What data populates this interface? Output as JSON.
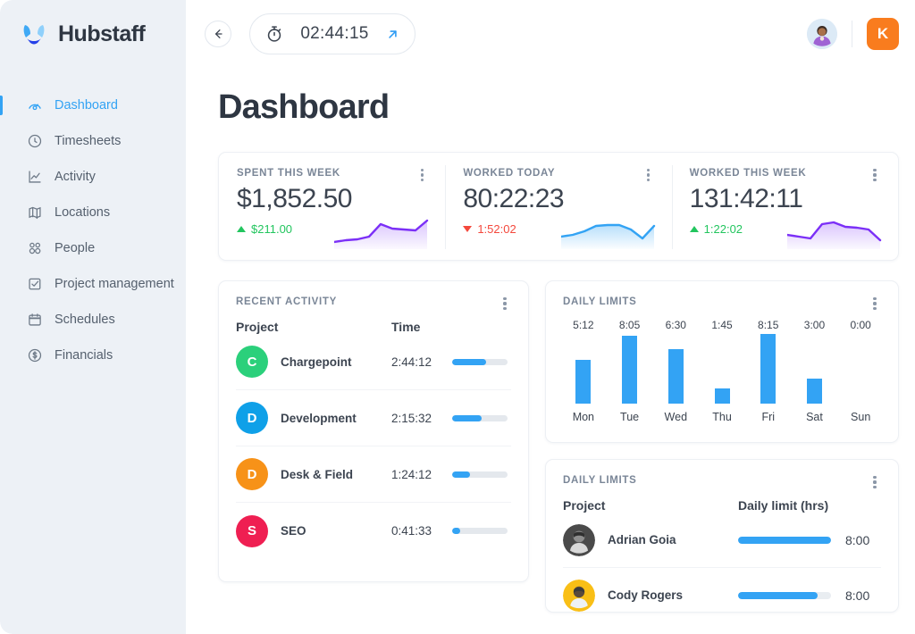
{
  "brand": {
    "name": "Hubstaff",
    "logo_icon": "hubstaff-logo-icon"
  },
  "sidebar": {
    "items": [
      {
        "label": "Dashboard",
        "icon": "speedometer-icon",
        "active": true
      },
      {
        "label": "Timesheets",
        "icon": "clock-icon",
        "active": false
      },
      {
        "label": "Activity",
        "icon": "chart-line-icon",
        "active": false
      },
      {
        "label": "Locations",
        "icon": "map-icon",
        "active": false
      },
      {
        "label": "People",
        "icon": "people-icon",
        "active": false
      },
      {
        "label": "Project management",
        "icon": "checkbox-task-icon",
        "active": false
      },
      {
        "label": "Schedules",
        "icon": "calendar-icon",
        "active": false
      },
      {
        "label": "Financials",
        "icon": "dollar-circle-icon",
        "active": false
      }
    ]
  },
  "topbar": {
    "back_icon": "arrow-left-icon",
    "timer": {
      "icon": "stopwatch-icon",
      "value": "02:44:15",
      "expand_icon": "arrow-up-right-icon"
    },
    "avatar_icon": "user-avatar",
    "account_badge": "K",
    "account_badge_color": "#f97c1e"
  },
  "main": {
    "title": "Dashboard"
  },
  "stats": [
    {
      "label": "SPENT THIS WEEK",
      "value": "$1,852.50",
      "delta": "$211.00",
      "direction": "up",
      "spark_color": "#7b2ff7",
      "spark_points": [
        30,
        28,
        27,
        24,
        10,
        15,
        16,
        17,
        6
      ]
    },
    {
      "label": "WORKED TODAY",
      "value": "80:22:23",
      "delta": "1:52:02",
      "direction": "down",
      "spark_color": "#33a3f4",
      "spark_points": [
        24,
        22,
        18,
        12,
        11,
        11,
        16,
        26,
        12
      ]
    },
    {
      "label": "WORKED THIS WEEK",
      "value": "131:42:11",
      "delta": "1:22:02",
      "direction": "up",
      "spark_color": "#7b2ff7",
      "spark_points": [
        22,
        24,
        26,
        10,
        8,
        13,
        14,
        16,
        28
      ]
    }
  ],
  "recent_activity": {
    "title": "RECENT ACTIVITY",
    "columns": [
      "Project",
      "Time"
    ],
    "rows": [
      {
        "initial": "C",
        "color": "#2bd07b",
        "project": "Chargepoint",
        "time": "2:44:12",
        "progress": 62
      },
      {
        "initial": "D",
        "color": "#0fa0e8",
        "project": "Development",
        "time": "2:15:32",
        "progress": 54
      },
      {
        "initial": "D",
        "color": "#f79218",
        "project": "Desk & Field",
        "time": "1:24:12",
        "progress": 33
      },
      {
        "initial": "S",
        "color": "#ef1f52",
        "project": "SEO",
        "time": "0:41:33",
        "progress": 15
      }
    ]
  },
  "daily_limits_chart": {
    "title": "DAILY LIMITS"
  },
  "chart_data": {
    "type": "bar",
    "title": "DAILY LIMITS",
    "categories": [
      "Mon",
      "Tue",
      "Wed",
      "Thu",
      "Fri",
      "Sat",
      "Sun"
    ],
    "value_labels": [
      "5:12",
      "8:05",
      "6:30",
      "1:45",
      "8:15",
      "3:00",
      "0:00"
    ],
    "values": [
      5.2,
      8.083,
      6.5,
      1.75,
      8.25,
      3.0,
      0.0
    ],
    "ylabel": "",
    "xlabel": "",
    "ylim": [
      0,
      8.25
    ],
    "grid": false,
    "legend": "none",
    "bar_color": "#33a3f4"
  },
  "daily_limits_list": {
    "title": "DAILY LIMITS",
    "columns": [
      "Project",
      "Daily limit (hrs)"
    ],
    "rows": [
      {
        "name": "Adrian Goia",
        "limit": "8:00",
        "progress": 100,
        "avatar_icon": "user-avatar-adrian"
      },
      {
        "name": "Cody Rogers",
        "limit": "8:00",
        "progress": 86,
        "avatar_icon": "user-avatar-cody"
      }
    ]
  }
}
